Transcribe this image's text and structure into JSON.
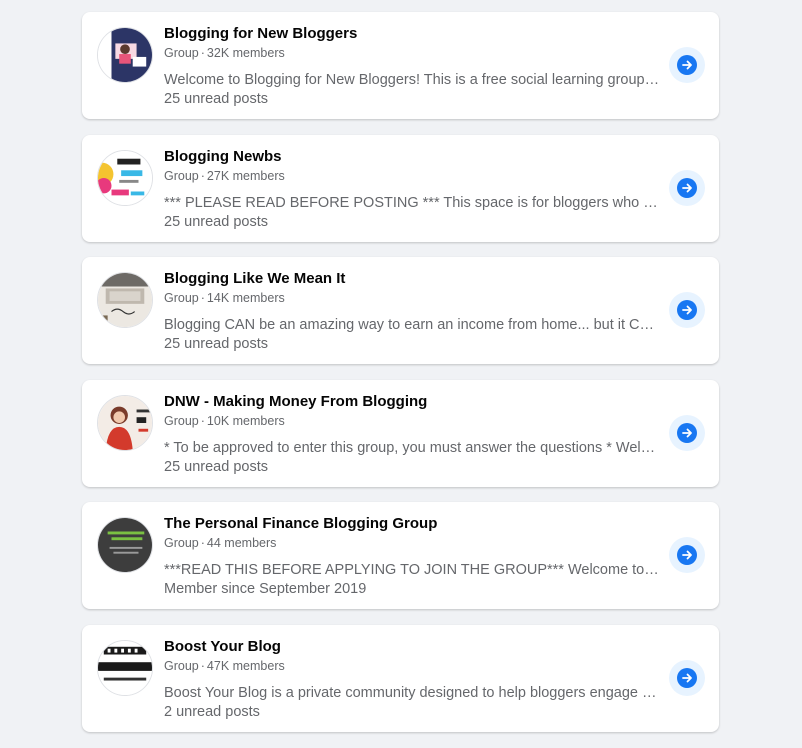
{
  "groups": [
    {
      "name": "Blogging for New Bloggers",
      "type": "Group",
      "members": "32K members",
      "description": "Welcome to Blogging for New Bloggers! This is a free social learning group hosted by...",
      "status": "25 unread posts",
      "avatar_colors": [
        "#2c3566",
        "#e8557a"
      ]
    },
    {
      "name": "Blogging Newbs",
      "type": "Group",
      "members": "27K members",
      "description": "*** PLEASE READ BEFORE POSTING *** This space is for bloggers who want to grow their blogs...",
      "status": "25 unread posts",
      "avatar_colors": [
        "#39b8e6",
        "#f4c430"
      ]
    },
    {
      "name": "Blogging Like We Mean It",
      "type": "Group",
      "members": "14K members",
      "description": "Blogging CAN be an amazing way to earn an income from home... but it CAN also be hard...",
      "status": "25 unread posts",
      "avatar_colors": [
        "#bfb8ae",
        "#6d6a66"
      ]
    },
    {
      "name": "DNW - Making Money From Blogging",
      "type": "Group",
      "members": "10K members",
      "description": "* To be approved to enter this group, you must answer the questions * Welcome to the group...",
      "status": "25 unread posts",
      "avatar_colors": [
        "#d33a2c",
        "#f3ece6"
      ]
    },
    {
      "name": "The Personal Finance Blogging Group",
      "type": "Group",
      "members": "44 members",
      "description": "***READ THIS BEFORE APPLYING TO JOIN THE GROUP*** Welcome to The Personal Finance...",
      "status": "Member since September 2019",
      "avatar_colors": [
        "#3d3d3d",
        "#7ac142"
      ]
    },
    {
      "name": "Boost Your Blog",
      "type": "Group",
      "members": "47K members",
      "description": "Boost Your Blog is a private community designed to help bloggers engage and grow...",
      "status": "2 unread posts",
      "avatar_colors": [
        "#1a1a1a",
        "#ffffff"
      ]
    }
  ],
  "accent_color": "#1877f2",
  "arrow_icon": "arrow-right-icon"
}
